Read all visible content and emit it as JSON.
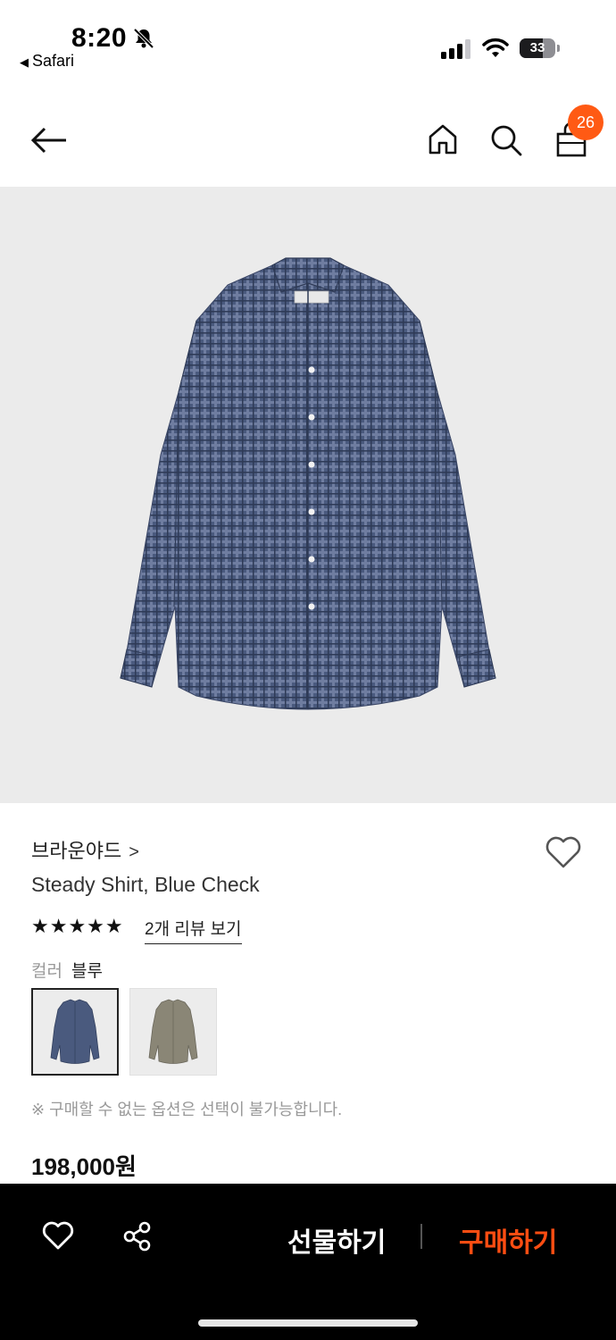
{
  "status_bar": {
    "time": "8:20",
    "back_app": "Safari",
    "battery": "33"
  },
  "nav": {
    "cart_count": "26"
  },
  "product": {
    "brand": "브라운야드",
    "brand_chevron": ">",
    "title": "Steady Shirt, Blue Check",
    "stars": "★★★★★",
    "review_link": "2개 리뷰 보기",
    "color_label": "컬러",
    "color_value": "블루",
    "notice": "※ 구매할 수 없는 옵션은 선택이 불가능합니다.",
    "price": "198,000원"
  },
  "bottom_bar": {
    "gift_label": "선물하기",
    "buy_label": "구매하기"
  },
  "colors": {
    "accent": "#ff5a14",
    "buy": "#ff4d12",
    "shirt_blue": "#4a5a7e",
    "shirt_khaki": "#8a8676"
  },
  "icons": [
    "back-arrow-icon",
    "home-icon",
    "search-icon",
    "shopping-bag-icon",
    "heart-icon",
    "share-icon",
    "bell-off-icon",
    "signal-icon",
    "wifi-icon",
    "battery-icon"
  ]
}
